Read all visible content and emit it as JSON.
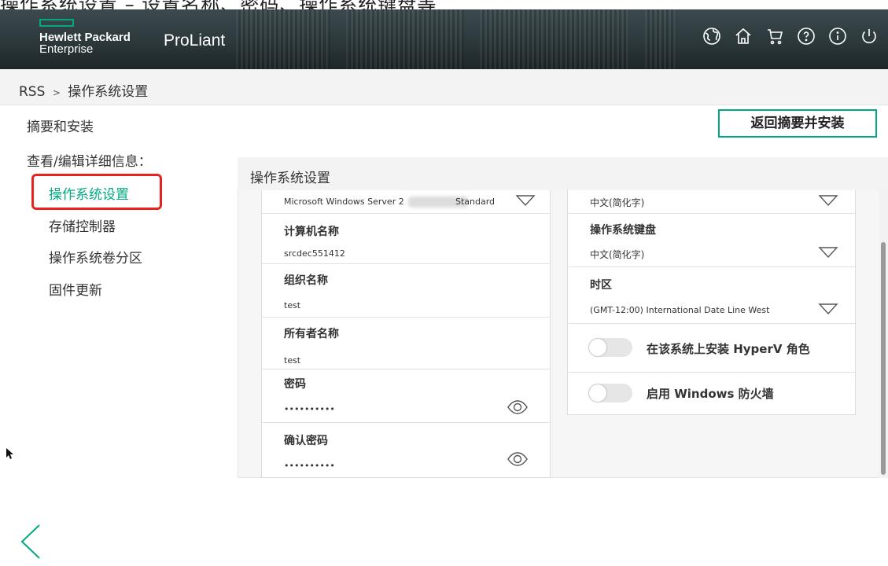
{
  "caption": "操作系统设置 – 设置名称、密码、操作系统键盘等",
  "header": {
    "brand_line1": "Hewlett Packard",
    "brand_line2": "Enterprise",
    "product": "ProLiant",
    "icons": [
      "language-icon",
      "home-icon",
      "cart-icon",
      "help-icon",
      "info-icon",
      "power-icon"
    ]
  },
  "breadcrumb": {
    "root": "RSS",
    "separator": ">",
    "current": "操作系统设置"
  },
  "nav": {
    "summary": "摘要和安装",
    "heading": "查看/编辑详细信息：",
    "items": [
      {
        "label": "操作系统设置",
        "active": true
      },
      {
        "label": "存储控制器",
        "active": false
      },
      {
        "label": "操作系统卷分区",
        "active": false
      },
      {
        "label": "固件更新",
        "active": false
      }
    ]
  },
  "back_button": "返回摘要并安装",
  "panel": {
    "title": "操作系统设置",
    "left": {
      "os_select": {
        "value_prefix": "Microsoft Windows Server 2",
        "value_suffix": "Standard"
      },
      "computer_name": {
        "label": "计算机名称",
        "value": "srcdec551412"
      },
      "org_name": {
        "label": "组织名称",
        "value": "test"
      },
      "owner_name": {
        "label": "所有者名称",
        "value": "test"
      },
      "password": {
        "label": "密码",
        "value": "••••••••••"
      },
      "confirm_password": {
        "label": "确认密码",
        "value": "••••••••••"
      }
    },
    "right": {
      "language": {
        "value": "中文(简化字)"
      },
      "keyboard": {
        "label": "操作系统键盘",
        "value": "中文(简化字)"
      },
      "timezone": {
        "label": "时区",
        "value": "(GMT-12:00) International Date Line West"
      },
      "hyperv_toggle": {
        "label": "在该系统上安装 HyperV 角色",
        "on": false
      },
      "firewall_toggle": {
        "label": "启用 Windows 防火墙",
        "on": false
      }
    }
  },
  "colors": {
    "accent": "#01a982",
    "highlight": "#e8231f",
    "header_bg": "#2c383b"
  }
}
